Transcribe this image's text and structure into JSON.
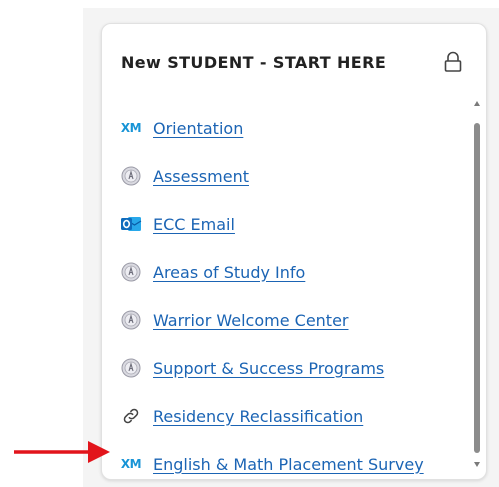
{
  "card": {
    "title": "New STUDENT - START HERE",
    "items": [
      {
        "label": "Orientation",
        "icon": "xm-logo-icon"
      },
      {
        "label": "Assessment",
        "icon": "college-seal-icon"
      },
      {
        "label": "ECC Email",
        "icon": "outlook-icon"
      },
      {
        "label": "Areas of Study Info",
        "icon": "college-seal-icon"
      },
      {
        "label": "Warrior Welcome Center",
        "icon": "college-seal-icon"
      },
      {
        "label": "Support & Success Programs",
        "icon": "college-seal-icon"
      },
      {
        "label": "Residency Reclassification",
        "icon": "link-icon"
      },
      {
        "label": "English & Math Placement Survey",
        "icon": "xm-logo-icon"
      }
    ],
    "xm_logo_text": "XM"
  },
  "colors": {
    "link": "#1b64b4",
    "xm": "#1894d6",
    "outlook": "#0f6cbd",
    "annotation_arrow": "#e2141b"
  }
}
